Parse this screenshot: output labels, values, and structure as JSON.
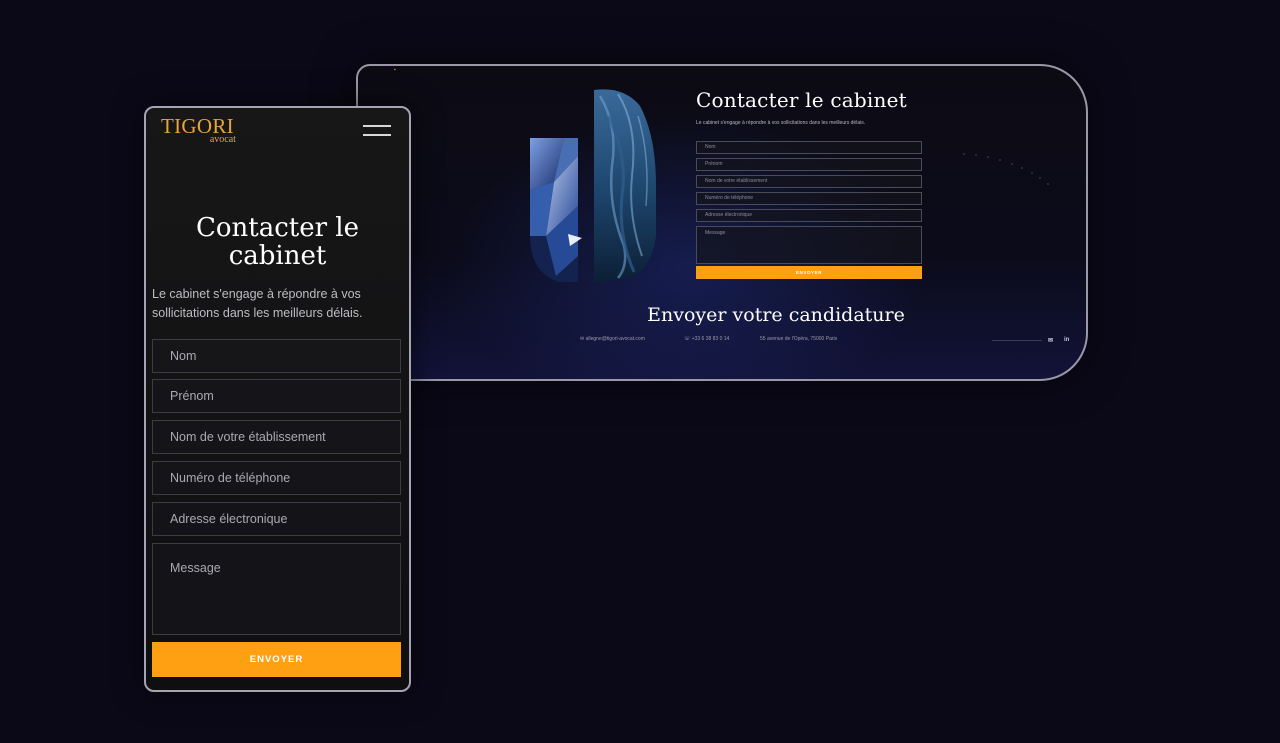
{
  "desktop": {
    "title": "Contacter le cabinet",
    "subtitle": "Le cabinet s'engage à répondre à vos sollicitations dans les meilleurs délais.",
    "fields": [
      "Nom",
      "Prénom",
      "Nom de votre établissement",
      "Numéro de téléphone",
      "Adresse électronique",
      "Message"
    ],
    "submit_label": "ENVOYER",
    "section_title": "Envoyer votre candidature",
    "email": "allegne@tigori-avocat.com",
    "phone": "+33 6 38 83 0 14",
    "address": "55 avenue de l'Opéra, 75000 Paris",
    "social": [
      "✉",
      "in"
    ]
  },
  "mobile": {
    "brand": "TIGORI",
    "brand_sub": "avocat",
    "title_line1": "Contacter le",
    "title_line2": "cabinet",
    "subtitle_line1": "Le cabinet s'engage à répondre à vos",
    "subtitle_line2": "sollicitations dans les meilleurs délais.",
    "fields": {
      "nom": "Nom",
      "prenom": "Prénom",
      "etablissement": "Nom de votre établissement",
      "telephone": "Numéro de téléphone",
      "email": "Adresse électronique",
      "message": "Message"
    },
    "submit_label": "ENVOYER"
  },
  "colors": {
    "background": "#0b0918",
    "accent": "#ffa012",
    "brand": "#e8a33a"
  }
}
